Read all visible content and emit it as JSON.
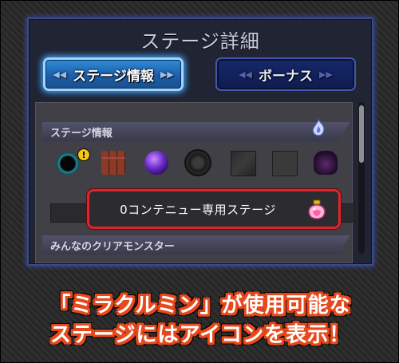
{
  "dialog": {
    "title": "ステージ詳細",
    "tabs": [
      {
        "label": "ステージ情報",
        "active": true
      },
      {
        "label": "ボーナス",
        "active": false
      }
    ]
  },
  "sections": {
    "stage_info_header": "ステージ情報",
    "clear_monsters_header": "みんなのクリアモンスター"
  },
  "gimmick_icons": [
    "black-hole-icon",
    "brick-block-icon",
    "purple-orb-icon",
    "mine-icon",
    "block-icon",
    "panel-icon",
    "boss-icon"
  ],
  "stage_note": "0コンテニュー専用ステージ",
  "caption": {
    "line1": "「ミラクルミン」が使用可能な",
    "line2": "ステージにはアイコンを表示！"
  },
  "colors": {
    "highlight": "#e0242b",
    "active_tab": "#1d5fa8",
    "caption_outline": "#e8491c"
  }
}
